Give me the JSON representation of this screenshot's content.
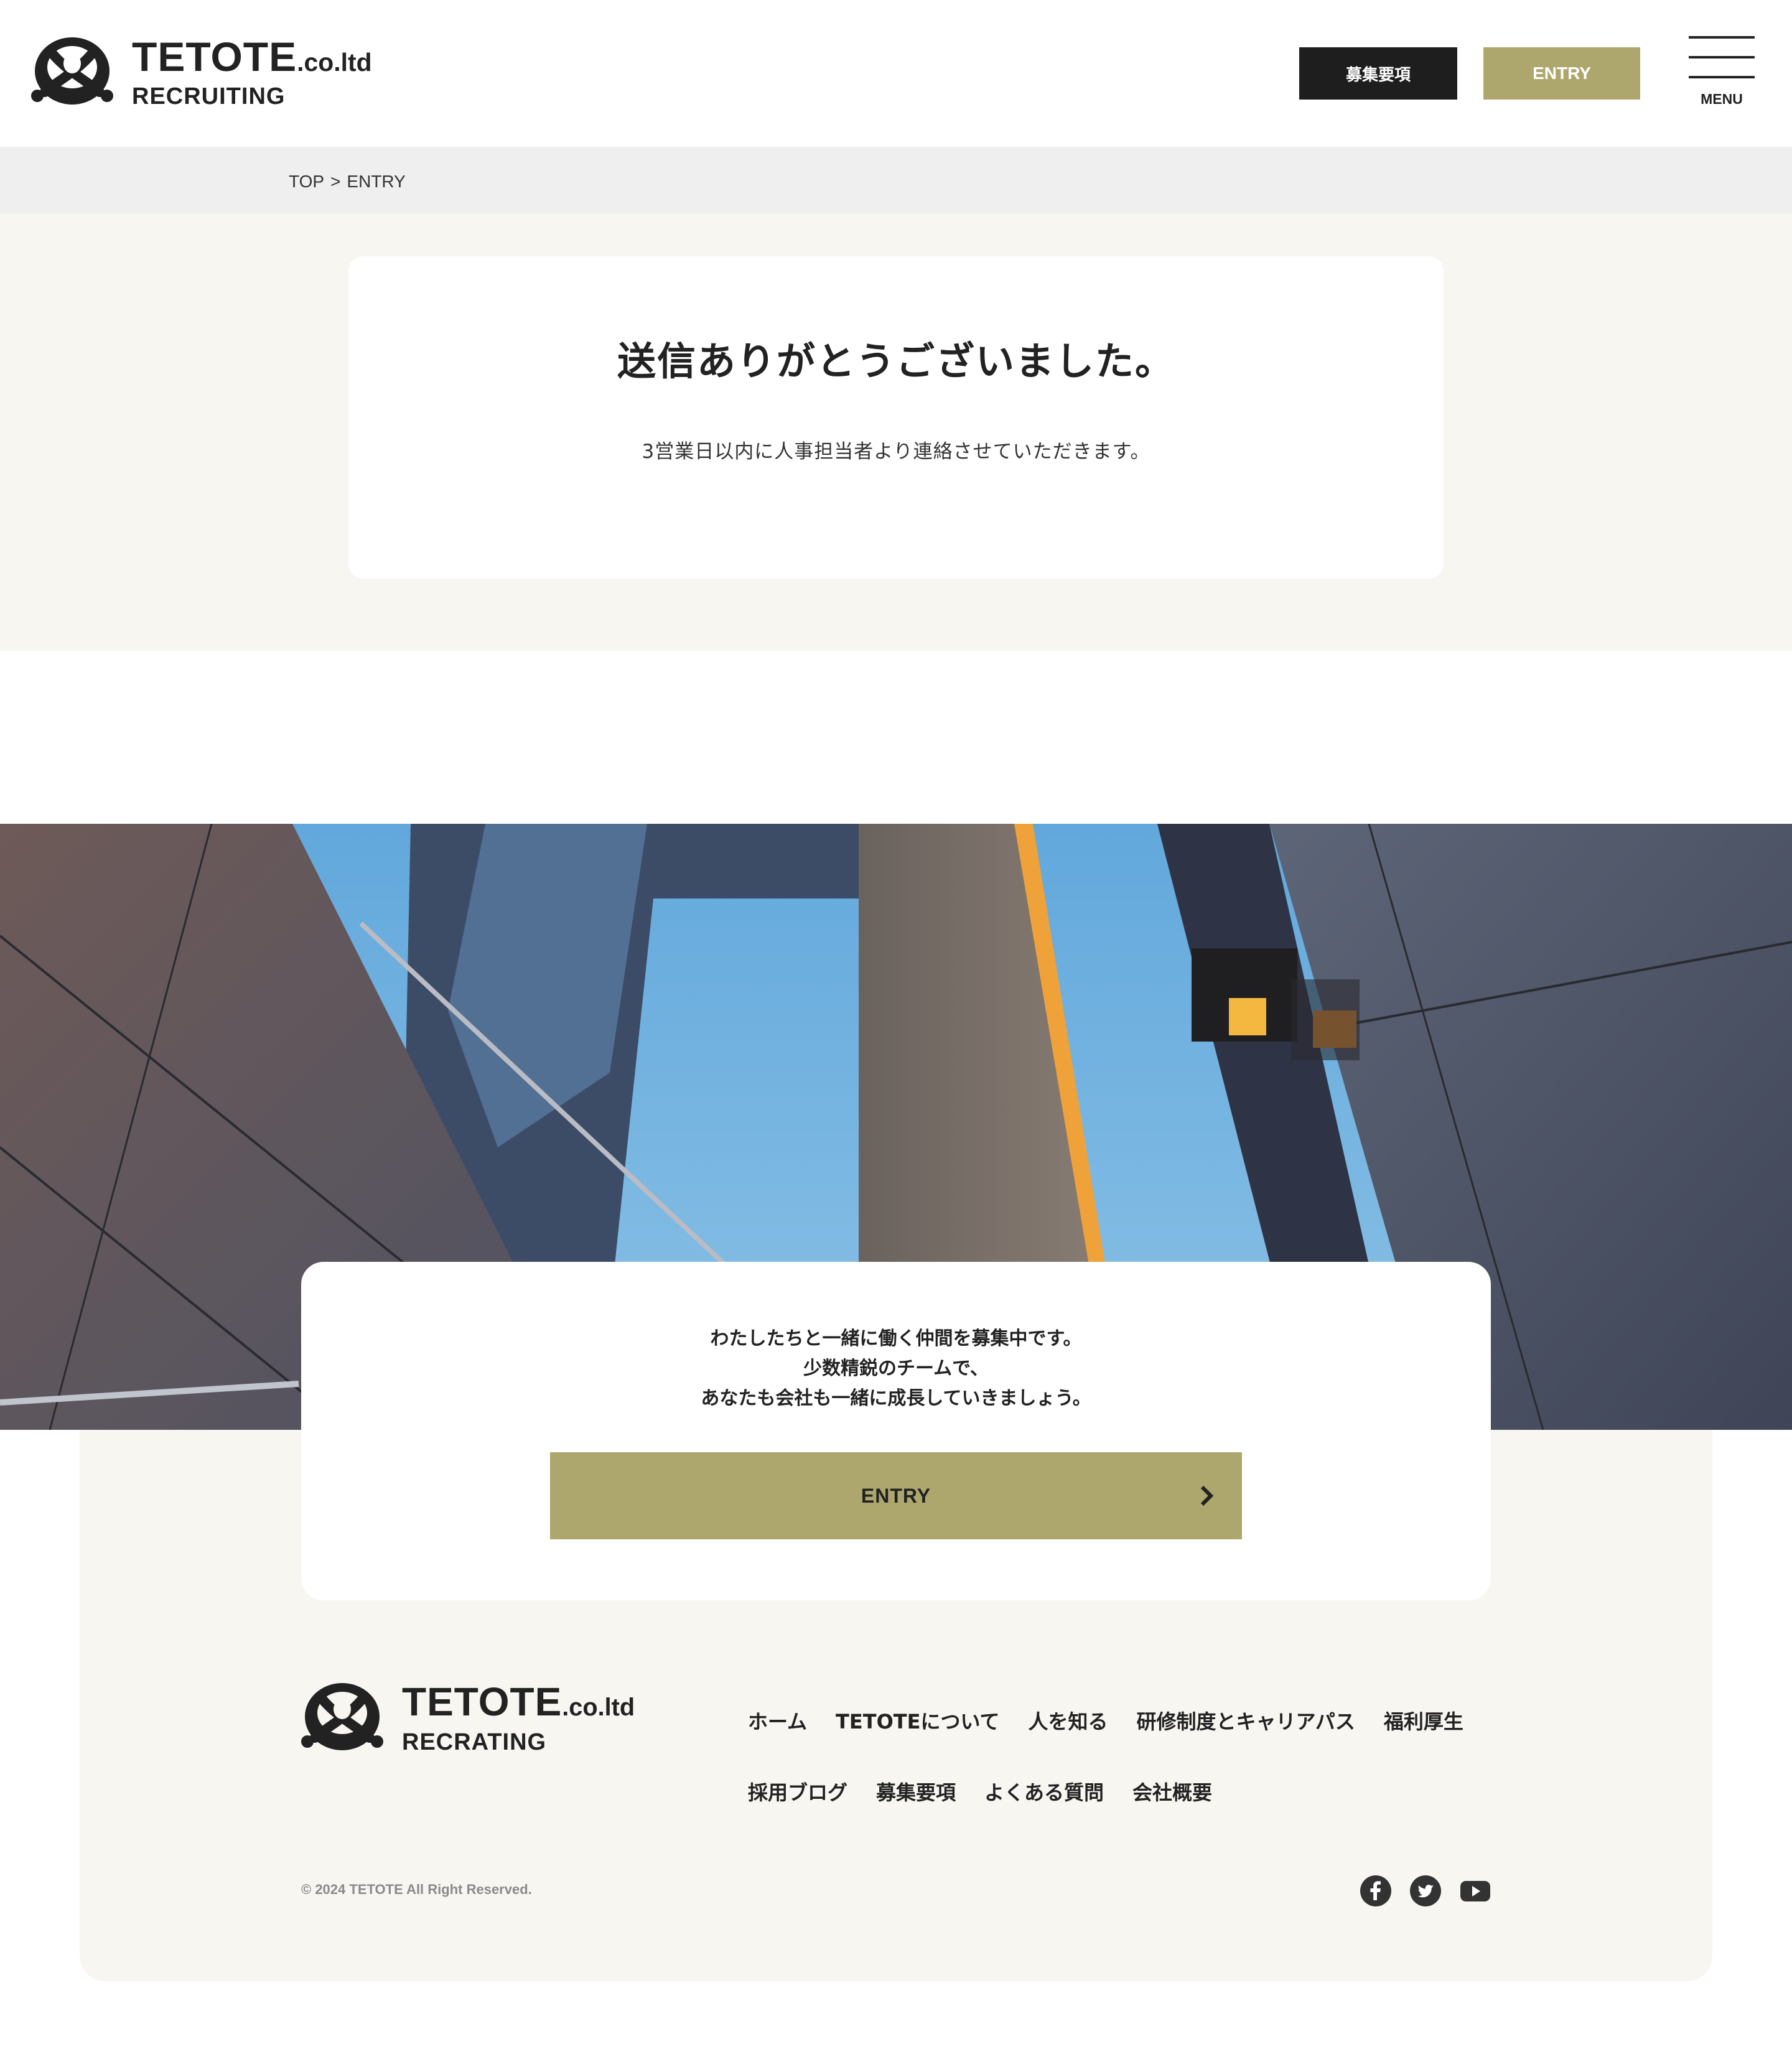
{
  "header": {
    "logo": {
      "name": "TETOTE",
      "suffix": ".co.ltd",
      "sub": "RECRUITING"
    },
    "recruit_button": "募集要項",
    "entry_button": "ENTRY",
    "menu_label": "MENU"
  },
  "breadcrumb": {
    "home": "TOP",
    "separator": ">",
    "current": "ENTRY"
  },
  "thanks": {
    "title": "送信ありがとうございました。",
    "message": "3営業日以内に人事担当者より連絡させていただきます。"
  },
  "cta": {
    "lines": [
      "わたしたちと一緒に働く仲間を募集中です。",
      "少数精鋭のチームで、",
      "あなたも会社も一緒に成長していきましょう。"
    ],
    "entry_button": "ENTRY"
  },
  "footer": {
    "logo": {
      "name": "TETOTE",
      "suffix": ".co.ltd",
      "sub": "RECRATING"
    },
    "nav_row1": [
      "ホーム",
      "TETOTEについて",
      "人を知る",
      "研修制度とキャリアパス",
      "福利厚生"
    ],
    "nav_row2": [
      "採用ブログ",
      "募集要項",
      "よくある質問",
      "会社概要"
    ],
    "copyright": "© 2024 TETOTE All Right Reserved.",
    "social_icons": [
      "facebook-icon",
      "twitter-icon",
      "youtube-icon"
    ]
  },
  "colors": {
    "accent": "#aea76d",
    "dark": "#1e1e1e",
    "section_bg": "#f8f6f1",
    "breadcrumb_bg": "#efefef"
  }
}
